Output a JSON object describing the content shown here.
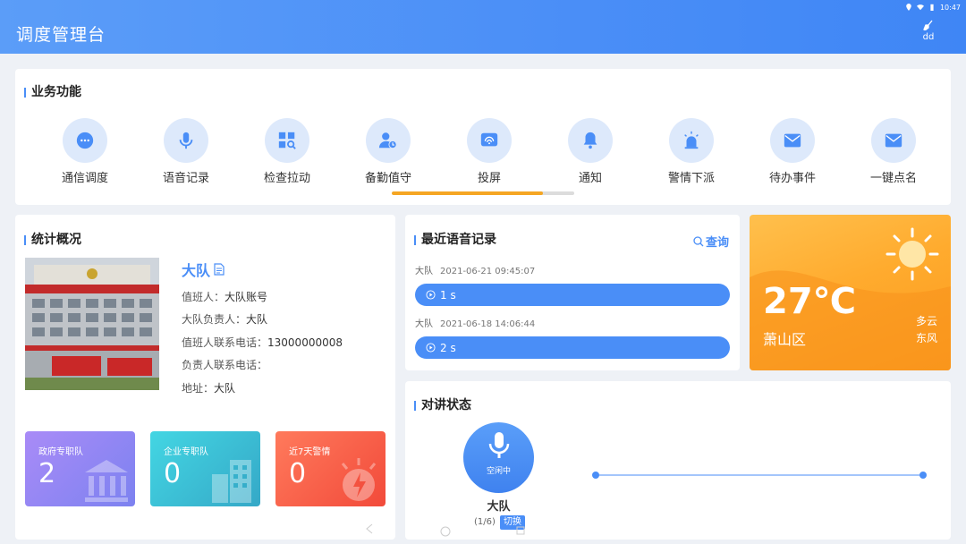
{
  "status_bar": {
    "time": "10:47"
  },
  "header": {
    "title": "调度管理台",
    "user": "dd"
  },
  "business": {
    "title": "业务功能",
    "items": [
      {
        "label": "通信调度",
        "icon": "chat-bubble-icon"
      },
      {
        "label": "语音记录",
        "icon": "microphone-icon"
      },
      {
        "label": "检查拉动",
        "icon": "grid-search-icon"
      },
      {
        "label": "备勤值守",
        "icon": "user-clock-icon"
      },
      {
        "label": "投屏",
        "icon": "screencast-icon"
      },
      {
        "label": "通知",
        "icon": "bell-icon"
      },
      {
        "label": "警情下派",
        "icon": "siren-icon"
      },
      {
        "label": "待办事件",
        "icon": "envelope-icon"
      },
      {
        "label": "一键点名",
        "icon": "envelope-icon"
      }
    ],
    "scroll_progress": 0.83
  },
  "stats": {
    "title": "统计概况",
    "team_name": "大队",
    "info": [
      {
        "label": "值班人：",
        "value": "大队账号"
      },
      {
        "label": "大队负责人：",
        "value": "大队"
      },
      {
        "label": "值班人联系电话：",
        "value": "13000000008"
      },
      {
        "label": "负责人联系电话：",
        "value": ""
      },
      {
        "label": "地址：",
        "value": "大队"
      }
    ],
    "boxes": [
      {
        "label": "政府专职队",
        "value": "2"
      },
      {
        "label": "企业专职队",
        "value": "0"
      },
      {
        "label": "近7天警情",
        "value": "0"
      }
    ]
  },
  "voice": {
    "title": "最近语音记录",
    "query_label": "查询",
    "records": [
      {
        "team": "大队",
        "time": "2021-06-21 09:45:07",
        "duration": "1 s"
      },
      {
        "team": "大队",
        "time": "2021-06-18 14:06:44",
        "duration": "2 s"
      }
    ]
  },
  "weather": {
    "temperature": "27℃",
    "district": "萧山区",
    "condition": "多云",
    "wind": "东风"
  },
  "intercom": {
    "title": "对讲状态",
    "status": "空闲中",
    "name": "大队",
    "page": "(1/6)",
    "switch_label": "切换"
  },
  "colors": {
    "accent": "#4a8ef7",
    "scroll_thumb": "#f5a623",
    "weather": "#ffab2e"
  }
}
